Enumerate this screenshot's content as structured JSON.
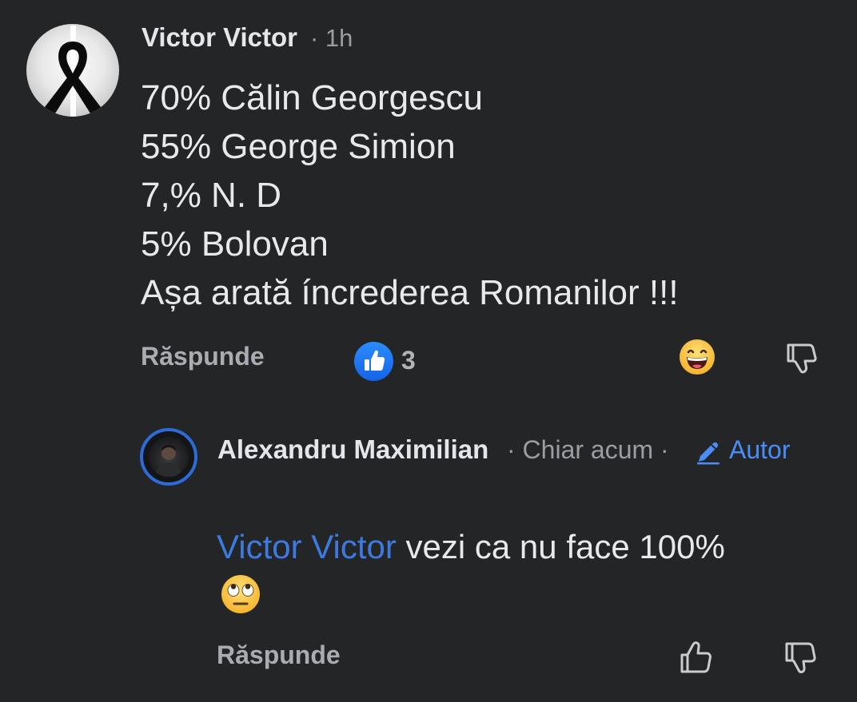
{
  "comment": {
    "author": "Victor Victor",
    "time": "· 1h",
    "lines": [
      "70% Călin Georgescu",
      "55% George Simion",
      "7,% N. D",
      "5% Bolovan",
      "Așa arată íncrederea Romanilor !!!"
    ],
    "reply_label": "Răspunde",
    "like_count": "3",
    "avatar_icon": "black-mourning-ribbon-icon",
    "reaction_icon": "grinning-face-emoji-icon"
  },
  "reply": {
    "author": "Alexandru Maximilian",
    "time": "· Chiar acum ·",
    "badge": "Autor",
    "mention": "Victor Victor",
    "text": " vezi ca nu face 100%",
    "emoji_icon": "face-with-rolling-eyes-emoji-icon",
    "reply_label": "Răspunde"
  },
  "colors": {
    "background": "#242526",
    "accent": "#4b8df7",
    "mention": "#3d7ae0",
    "like_badge": "#1877f2"
  }
}
